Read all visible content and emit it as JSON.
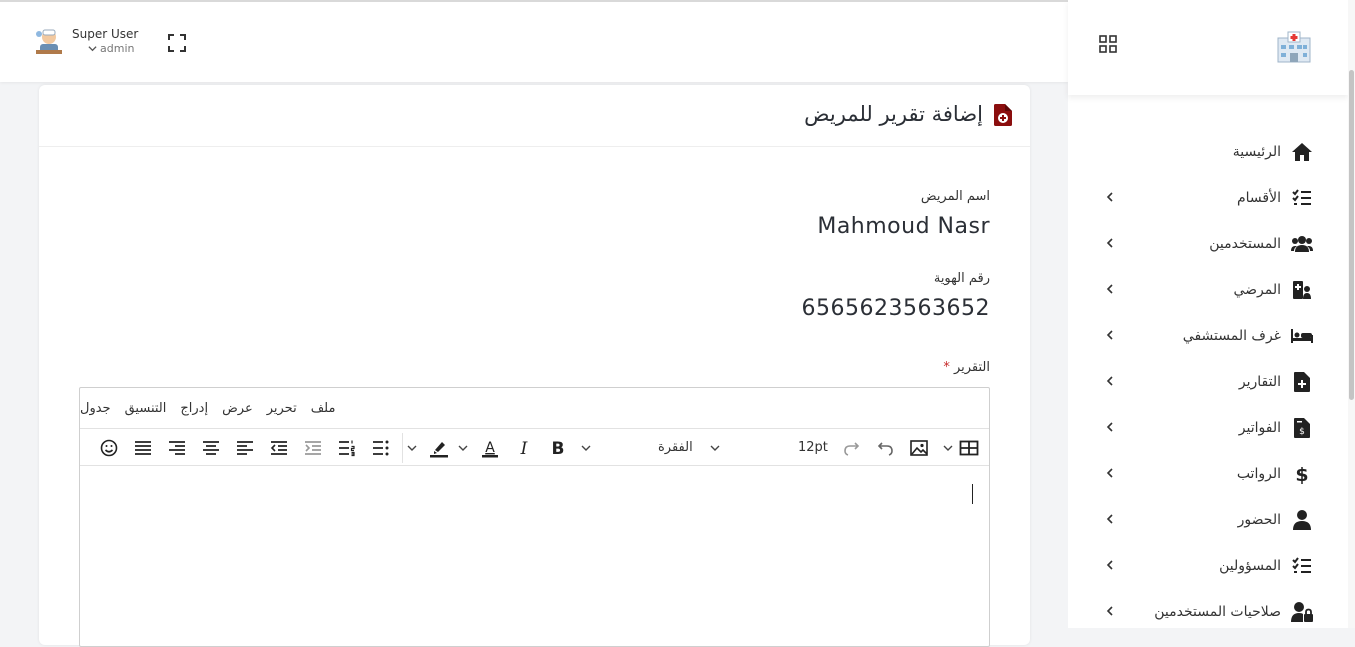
{
  "user": {
    "name": "Super User",
    "role": "admin"
  },
  "sidebar": {
    "items": [
      {
        "label": "الرئيسية",
        "icon": "home-icon"
      },
      {
        "label": "الأقسام",
        "icon": "list-check-icon"
      },
      {
        "label": "المستخدمين",
        "icon": "users-icon"
      },
      {
        "label": "المرضي",
        "icon": "patient-icon"
      },
      {
        "label": "غرف المستشفي",
        "icon": "bed-icon"
      },
      {
        "label": "التقارير",
        "icon": "file-medical-icon"
      },
      {
        "label": "الفواتير",
        "icon": "invoice-icon"
      },
      {
        "label": "الرواتب",
        "icon": "dollar-icon"
      },
      {
        "label": "الحضور",
        "icon": "user-icon"
      },
      {
        "label": "المسؤولين",
        "icon": "list-check-icon"
      },
      {
        "label": "صلاحيات المستخدمين",
        "icon": "user-lock-icon"
      }
    ]
  },
  "page": {
    "title": "إضافة تقرير للمريض",
    "patient_name_label": "اسم المريض",
    "patient_name": "Mahmoud Nasr",
    "id_label": "رقم الهوية",
    "id_value": "6565623563652",
    "report_label": "التقرير",
    "required_mark": "*"
  },
  "editor": {
    "menu": [
      "ملف",
      "تحرير",
      "عرض",
      "إدراج",
      "التنسيق",
      "جدول"
    ],
    "font_size": "12pt",
    "block_format": "الفقرة"
  },
  "colors": {
    "accent": "#8b0e0e",
    "text": "#2b2f36"
  }
}
